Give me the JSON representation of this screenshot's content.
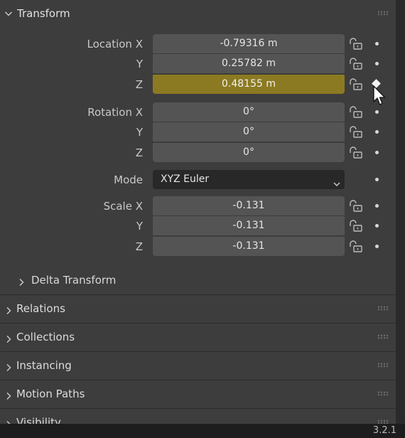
{
  "transform": {
    "title": "Transform",
    "location": {
      "label": "Location X",
      "y_label": "Y",
      "z_label": "Z",
      "x": "-0.79316 m",
      "y": "0.25782 m",
      "z": "0.48155 m"
    },
    "rotation": {
      "label": "Rotation X",
      "y_label": "Y",
      "z_label": "Z",
      "x": "0°",
      "y": "0°",
      "z": "0°"
    },
    "mode": {
      "label": "Mode",
      "value": "XYZ Euler"
    },
    "scale": {
      "label": "Scale X",
      "y_label": "Y",
      "z_label": "Z",
      "x": "-0.131",
      "y": "-0.131",
      "z": "-0.131"
    },
    "delta_transform": "Delta Transform"
  },
  "panels": [
    "Relations",
    "Collections",
    "Instancing",
    "Motion Paths",
    "Visibility"
  ],
  "version": "3.2.1",
  "colors": {
    "keyed_field": "#8c7a22",
    "field": "#545454",
    "panel": "#3d3d3d"
  },
  "icons": [
    "chevron-down-icon",
    "chevron-right-icon",
    "lock-icon",
    "keyframe-dot-icon",
    "keyframe-diamond-icon",
    "mouse-cursor-icon",
    "drag-grip-icon"
  ]
}
